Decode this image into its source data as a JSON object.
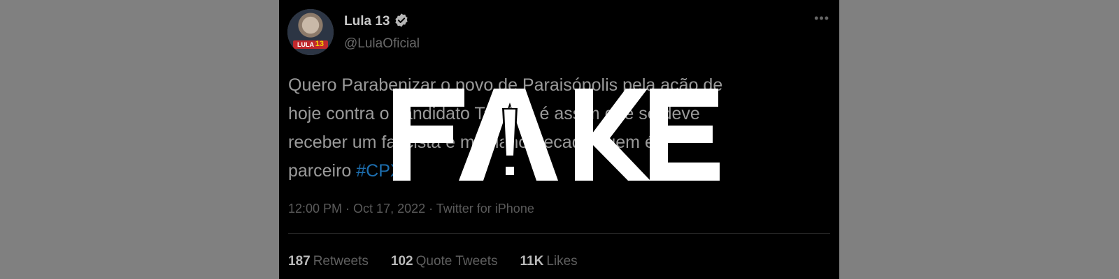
{
  "tweet": {
    "name": "Lula 13",
    "handle": "@LulaOficial",
    "avatar_badge_text": "LULA",
    "avatar_badge_number": "13",
    "more_icon": "•••",
    "text_before_tag": "Quero Parabenizar o povo de Paraisópolis pela ação de\nhoje contra o candidato Tarcício é assim que se deve\nreceber um fascista e miliciano, recado quem é\nparceiro ",
    "hashtag": "#CPX",
    "timestamp": "12:00 PM · Oct 17, 2022 · Twitter for iPhone",
    "stats": {
      "retweets_count": "187",
      "retweets_label": "Retweets",
      "quotes_count": "102",
      "quotes_label": "Quote Tweets",
      "likes_count": "11K",
      "likes_label": "Likes"
    }
  },
  "overlay": {
    "label": "FAKE",
    "color": "#ffffff"
  }
}
